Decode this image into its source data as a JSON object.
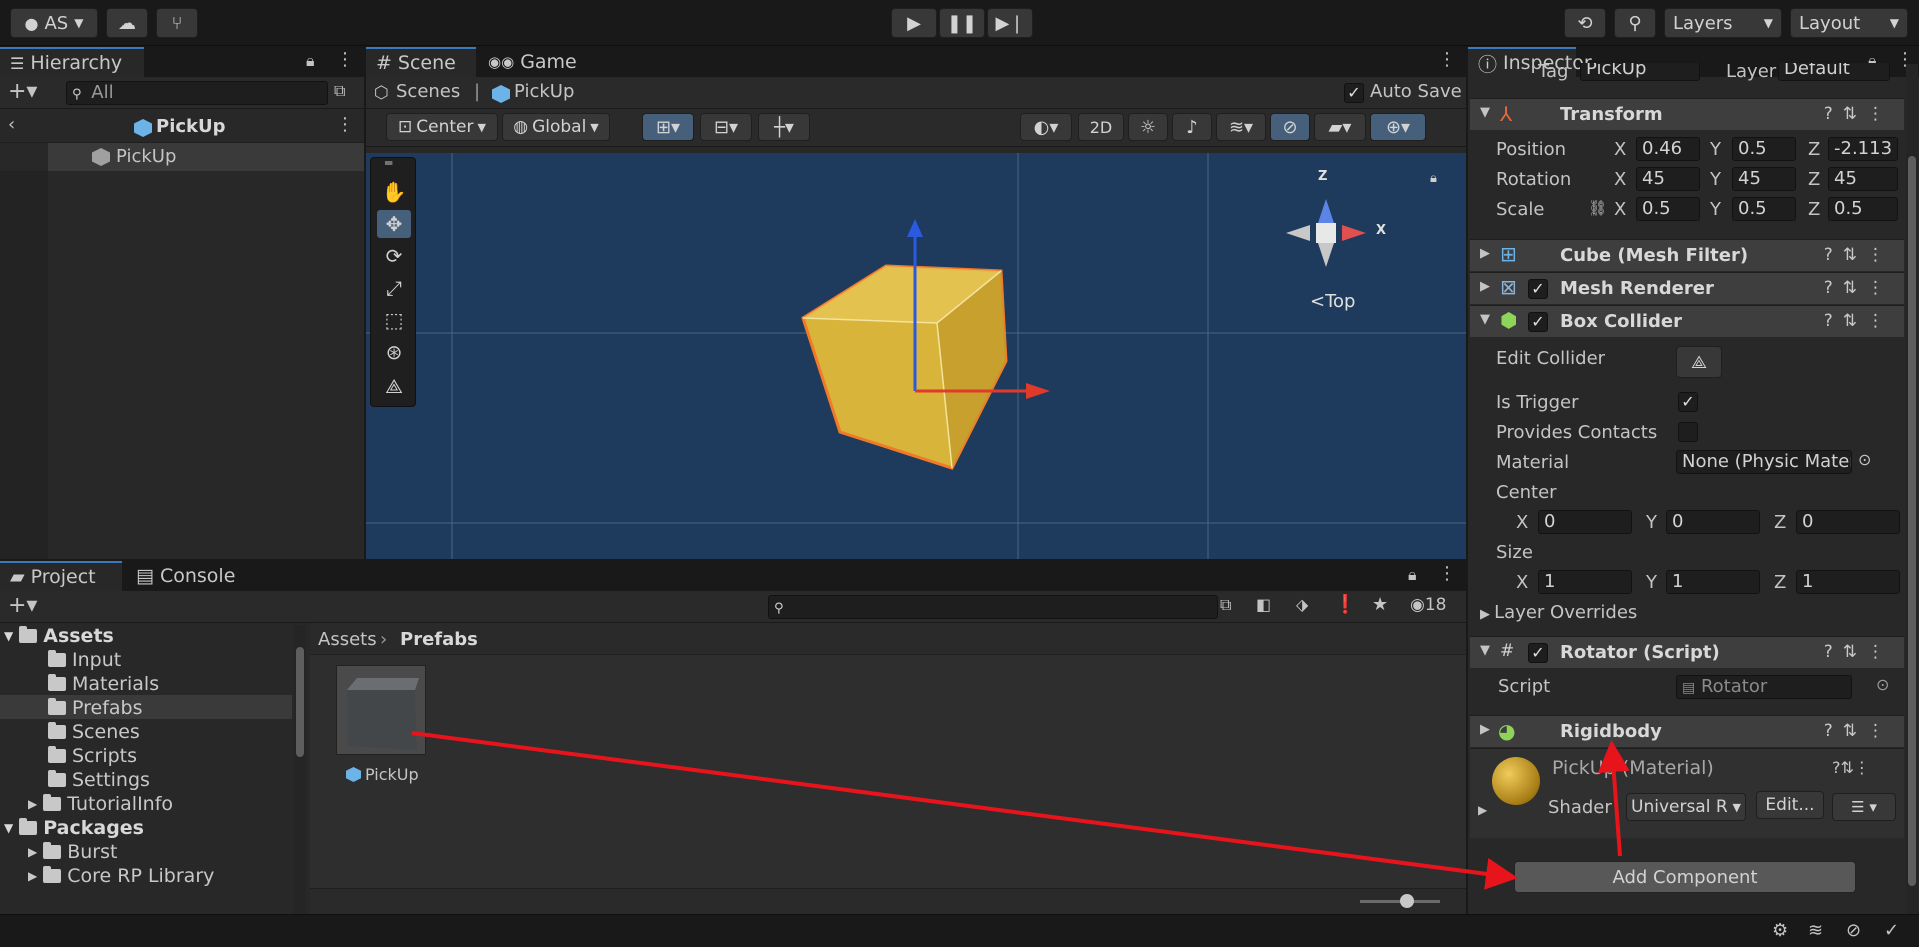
{
  "toolbar": {
    "account": "AS",
    "layers": "Layers",
    "layout": "Layout"
  },
  "hierarchy": {
    "tab": "Hierarchy",
    "search_placeholder": "All",
    "scene_root": "PickUp",
    "child": "PickUp"
  },
  "scene": {
    "tab_scene": "Scene",
    "tab_game": "Game",
    "breadcrumb_root": "Scenes",
    "breadcrumb_item": "PickUp",
    "auto_save": "Auto Save",
    "pivot": "Center",
    "space": "Global",
    "mode_2d": "2D",
    "gizmo_view": "Top",
    "gizmo_y": "Z",
    "gizmo_x": "X"
  },
  "project": {
    "tab_project": "Project",
    "tab_console": "Console",
    "count": "18",
    "breadcrumb_root": "Assets",
    "breadcrumb_current": "Prefabs",
    "tree": [
      {
        "label": "Assets",
        "bold": true
      },
      {
        "label": "Input"
      },
      {
        "label": "Materials"
      },
      {
        "label": "Prefabs"
      },
      {
        "label": "Scenes"
      },
      {
        "label": "Scripts"
      },
      {
        "label": "Settings"
      },
      {
        "label": "TutorialInfo"
      },
      {
        "label": "Packages",
        "bold": true
      },
      {
        "label": "Burst"
      },
      {
        "label": "Core RP Library"
      }
    ],
    "asset_name": "PickUp"
  },
  "inspector": {
    "tab": "Inspector",
    "tag_label": "Tag",
    "tag_value": "PickUp",
    "layer_label": "Layer",
    "layer_value": "Default",
    "transform": {
      "title": "Transform",
      "position_label": "Position",
      "rotation_label": "Rotation",
      "scale_label": "Scale",
      "position": {
        "x": "0.46",
        "y": "0.5",
        "z": "-2.113"
      },
      "rotation": {
        "x": "45",
        "y": "45",
        "z": "45"
      },
      "scale": {
        "x": "0.5",
        "y": "0.5",
        "z": "0.5"
      }
    },
    "mesh_filter": "Cube (Mesh Filter)",
    "mesh_renderer": "Mesh Renderer",
    "box_collider": {
      "title": "Box Collider",
      "edit_collider": "Edit Collider",
      "is_trigger": "Is Trigger",
      "provides_contacts": "Provides Contacts",
      "material_label": "Material",
      "material_value": "None (Physic Materia",
      "center_label": "Center",
      "center": {
        "x": "0",
        "y": "0",
        "z": "0"
      },
      "size_label": "Size",
      "size": {
        "x": "1",
        "y": "1",
        "z": "1"
      },
      "layer_overrides": "Layer Overrides"
    },
    "rotator": {
      "title": "Rotator (Script)",
      "script_label": "Script",
      "script_value": "Rotator"
    },
    "rigidbody": "Rigidbody",
    "material": {
      "name": "PickUp (Material)",
      "shader_label": "Shader",
      "shader_value": "Universal R",
      "edit": "Edit..."
    },
    "add_component": "Add Component"
  },
  "axis_labels": {
    "x": "X",
    "y": "Y",
    "z": "Z"
  },
  "colors": {
    "accent": "#3a79bb",
    "scene_bg": "#1e3a5c",
    "cube": "#d8b43a",
    "selection_outline": "#f07a28",
    "annotation_arrow": "#e8141c"
  }
}
